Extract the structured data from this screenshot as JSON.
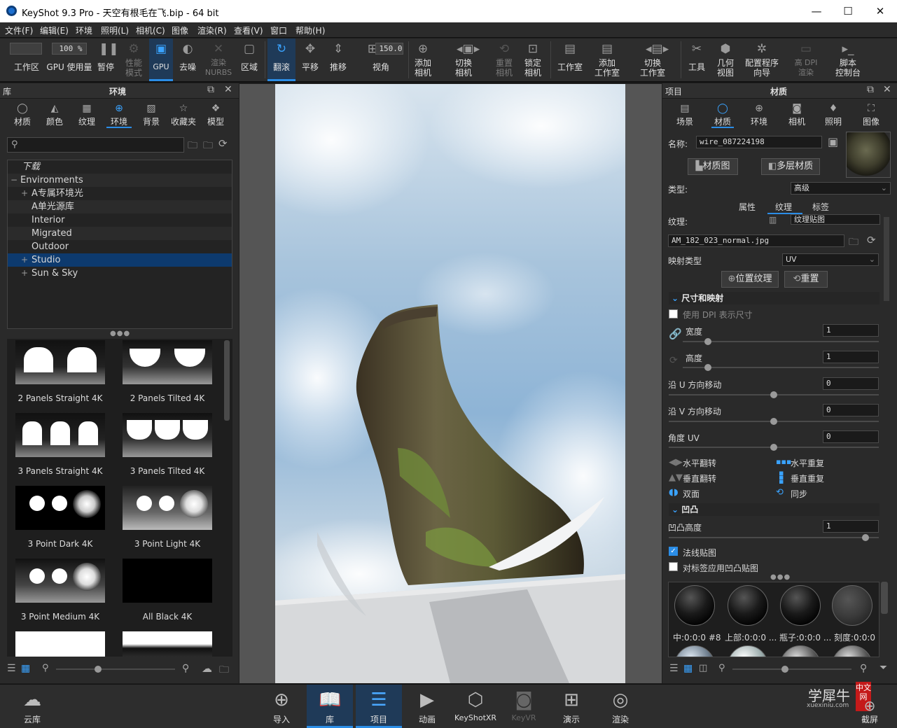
{
  "window": {
    "title": "KeyShot 9.3 Pro  - 天空有根毛在飞.bip  - 64 bit",
    "min": "—",
    "max": "☐",
    "close": "✕"
  },
  "menu": [
    "文件(F)",
    "编辑(E)",
    "环境",
    "照明(L)",
    "相机(C)",
    "图像",
    "渲染(R)",
    "查看(V)",
    "窗口",
    "帮助(H)"
  ],
  "toolbar": {
    "workspace_label": "工作区",
    "gpu_usage_label": "GPU 使用量",
    "gpu_usage_value": "100 %",
    "pause": "暂停",
    "perf_mode": "性能\n模式",
    "gpu": "GPU",
    "denoise": "去噪",
    "render_nurbs": "渲染\nNURBS",
    "region": "区域",
    "tumble": "翻滚",
    "pan": "平移",
    "dolly": "推移",
    "fov_label": "视角",
    "fov_value": "150.0",
    "add_camera": "添加\n相机",
    "switch_camera": "切换\n相机",
    "reset_camera": "重置\n相机",
    "lock_camera": "锁定\n相机",
    "studio": "工作室",
    "add_studio": "添加\n工作室",
    "switch_studio": "切换\n工作室",
    "tools": "工具",
    "geometry_view": "几何\n视图",
    "config_wizard": "配置程序\n向导",
    "high_dpi": "高 DPI\n渲染",
    "script_console": "脚本\n控制台"
  },
  "library": {
    "header_left": "库",
    "header_title": "环境",
    "tabs": [
      "材质",
      "颜色",
      "纹理",
      "环境",
      "背景",
      "收藏夹",
      "模型"
    ],
    "active_tab": "环境",
    "search_placeholder": "",
    "tree": [
      {
        "label": "下载",
        "indent": 0,
        "expander": ""
      },
      {
        "label": "Environments",
        "indent": 0,
        "expander": "−"
      },
      {
        "label": "A专属环境光",
        "indent": 1,
        "expander": "+"
      },
      {
        "label": "A单光源库",
        "indent": 1,
        "expander": ""
      },
      {
        "label": "Interior",
        "indent": 1,
        "expander": ""
      },
      {
        "label": "Migrated",
        "indent": 1,
        "expander": ""
      },
      {
        "label": "Outdoor",
        "indent": 1,
        "expander": ""
      },
      {
        "label": "Studio",
        "indent": 1,
        "expander": "+",
        "selected": true
      },
      {
        "label": "Sun & Sky",
        "indent": 1,
        "expander": "+"
      }
    ],
    "thumbnails": [
      {
        "name": "2 Panels Straight 4K"
      },
      {
        "name": "2 Panels Tilted 4K"
      },
      {
        "name": "3 Panels Straight 4K"
      },
      {
        "name": "3 Panels Tilted 4K"
      },
      {
        "name": "3 Point Dark 4K"
      },
      {
        "name": "3 Point Light 4K"
      },
      {
        "name": "3 Point Medium 4K"
      },
      {
        "name": "All Black 4K"
      }
    ]
  },
  "project": {
    "header_left": "项目",
    "header_title": "材质",
    "tabs": [
      "场景",
      "材质",
      "环境",
      "相机",
      "照明",
      "图像"
    ],
    "active_tab": "材质",
    "name_label": "名称:",
    "name_value": "wire_087224198",
    "material_graph_btn": "材质图",
    "multi_material_btn": "多层材质",
    "type_label": "类型:",
    "type_value": "高级",
    "subtabs": [
      "属性",
      "纹理",
      "标签"
    ],
    "active_subtab": "纹理",
    "texture_label": "纹理:",
    "texture_value": "纹理贴图",
    "texture_file": "AM_182_023_normal.jpg",
    "mapping_label": "映射类型",
    "mapping_value": "UV",
    "position_texture_btn": "位置纹理",
    "reset_btn": "重置",
    "section_size": "尺寸和映射",
    "use_dpi": "使用 DPI 表示尺寸",
    "width_label": "宽度",
    "width_value": "1",
    "height_label": "高度",
    "height_value": "1",
    "shift_u_label": "沿 U 方向移动",
    "shift_u_value": "0",
    "shift_v_label": "沿 V 方向移动",
    "shift_v_value": "0",
    "angle_label": "角度 UV",
    "angle_value": "0",
    "flip_h": "水平翻转",
    "repeat_h": "水平重复",
    "flip_v": "垂直翻转",
    "repeat_v": "垂直重复",
    "two_sided": "双面",
    "sync": "同步",
    "section_bump": "凹凸",
    "bump_height_label": "凹凸高度",
    "bump_height_value": "1",
    "normal_map": "法线贴图",
    "normal_map_checked": true,
    "label_bump": "对标签应用凹凸贴图",
    "label_bump_checked": false,
    "material_thumbs": [
      "中:0:0:0 #8",
      "上部:0:0:0 ...",
      "瓶子:0:0:0 ...",
      "刻度:0:0:0 ..."
    ]
  },
  "dock": {
    "cloud": "云库",
    "import": "导入",
    "library": "库",
    "project": "项目",
    "animation": "动画",
    "keyshotxr": "KeyShotXR",
    "keyvr": "KeyVR",
    "presentation": "演示",
    "render": "渲染",
    "screenshot": "截屏",
    "watermark": "学犀牛",
    "watermark_url": "xuexiniu.com",
    "watermark_badge": "中文网"
  },
  "colors": {
    "accent": "#2b8de6",
    "panel": "#2d2d2d",
    "selected_row": "#0d3a6e"
  }
}
